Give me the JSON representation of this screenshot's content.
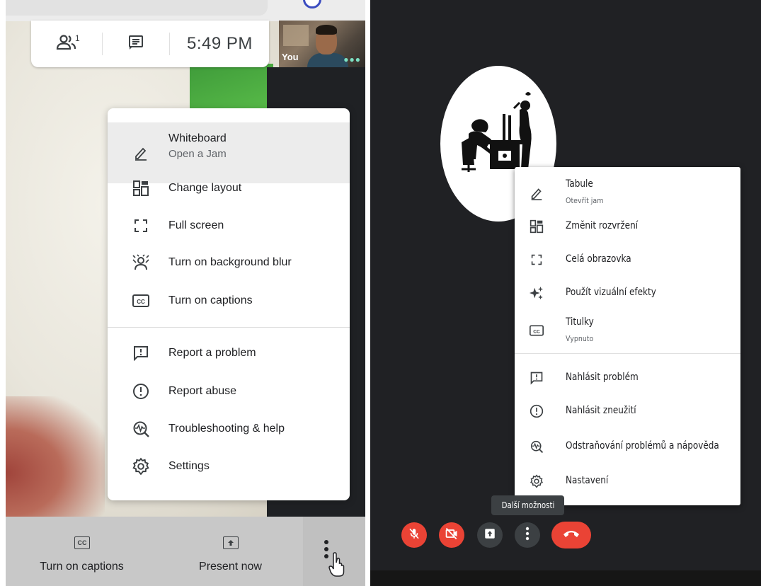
{
  "left_panel": {
    "topbar": {
      "participants_count": "1",
      "time": "5:49 PM",
      "self_label": "You"
    },
    "menu": {
      "items": [
        {
          "label": "Whiteboard",
          "sublabel": "Open a Jam",
          "icon": "pencil-icon"
        },
        {
          "label": "Change layout",
          "icon": "layout-icon"
        },
        {
          "label": "Full screen",
          "icon": "fullscreen-icon"
        },
        {
          "label": "Turn on background blur",
          "icon": "background-blur-icon"
        },
        {
          "label": "Turn on captions",
          "icon": "captions-icon"
        },
        {
          "label": "Report a problem",
          "icon": "report-problem-icon"
        },
        {
          "label": "Report abuse",
          "icon": "report-abuse-icon"
        },
        {
          "label": "Troubleshooting & help",
          "icon": "troubleshooting-icon"
        },
        {
          "label": "Settings",
          "icon": "settings-icon"
        }
      ]
    },
    "bottombar": {
      "captions_label": "Turn on captions",
      "captions_icon_text": "CC",
      "present_label": "Present now"
    }
  },
  "right_panel": {
    "menu": {
      "items": [
        {
          "label": "Tabule",
          "sublabel": "Otevřít jam",
          "icon": "pencil-icon"
        },
        {
          "label": "Změnit rozvržení",
          "icon": "layout-icon"
        },
        {
          "label": "Celá obrazovka",
          "icon": "fullscreen-icon"
        },
        {
          "label": "Použít vizuální efekty",
          "icon": "sparkle-icon"
        },
        {
          "label": "Titulky",
          "sublabel": "Vypnuto",
          "icon": "captions-icon"
        },
        {
          "label": "Nahlásit problém",
          "icon": "report-problem-icon"
        },
        {
          "label": "Nahlásit zneužití",
          "icon": "report-abuse-icon"
        },
        {
          "label": "Odstraňování problémů a nápověda",
          "icon": "troubleshooting-icon"
        },
        {
          "label": "Nastavení",
          "icon": "settings-icon"
        }
      ]
    },
    "tooltip": "Další možnosti",
    "controls": [
      "mic-off-icon",
      "camera-off-icon",
      "present-icon",
      "more-options-icon",
      "hang-up-icon"
    ]
  },
  "colors": {
    "meet_red": "#ea4335",
    "dark_bg": "#202124",
    "menu_text": "#202124",
    "secondary_text": "#5f6368"
  }
}
